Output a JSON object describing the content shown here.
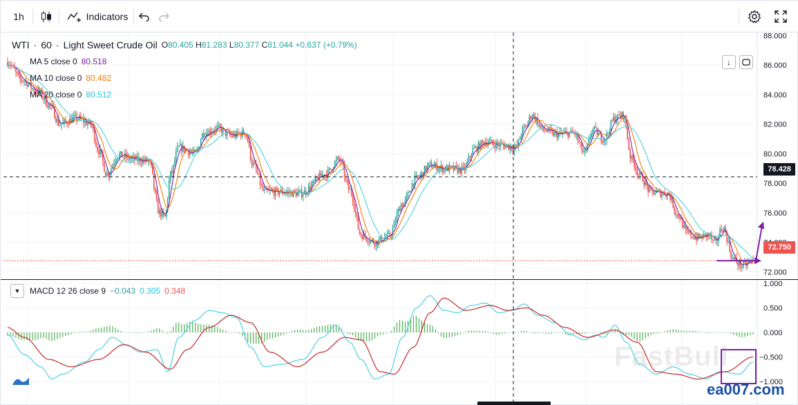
{
  "toolbar": {
    "interval": "1h",
    "indicators_label": "Indicators"
  },
  "legend": {
    "symbol": "WTI",
    "interval": "60",
    "name": "Light Sweet Crude Oil",
    "o_key": "O",
    "o_val": "80.405",
    "h_key": "H",
    "h_val": "81.283",
    "l_key": "L",
    "l_val": "80.377",
    "c_key": "C",
    "c_val": "81.044",
    "change": "+0.637 (+0.79%)",
    "ma5_label": "MA 5 close 0",
    "ma5_val": "80.518",
    "ma10_label": "MA 10 close 0",
    "ma10_val": "80.482",
    "ma20_label": "MA 20 close 0",
    "ma20_val": "80.512"
  },
  "macd_legend": {
    "label": "MACD 12 26 close 9",
    "hist_val": "−0.043",
    "macd_val": "0.305",
    "signal_val": "0.348"
  },
  "price_tags": {
    "crosshair": "78.428",
    "last": "72.750"
  },
  "watermarks": {
    "primary": "FastBull",
    "secondary": "ea007.com"
  },
  "colors": {
    "up": "#26a69a",
    "down": "#ef5350",
    "ma5": "#7b1fa2",
    "ma10": "#f57c00",
    "ma20": "#4dd0e1",
    "macd": "#4dd0e1",
    "signal": "#c62828",
    "hist": "#4caf50",
    "crosshair_tag": "#131722",
    "last_tag": "#ef5350",
    "annotation": "#7b1fa2"
  },
  "chart_data": [
    {
      "type": "candlestick",
      "symbol": "WTI",
      "y_ticks": [
        88,
        86,
        84,
        82,
        80,
        78,
        76,
        74,
        72
      ],
      "ylim": [
        71.5,
        88.2
      ],
      "crosshair_price": 78.428,
      "last_price": 72.75,
      "anchors": [
        [
          0,
          86.2
        ],
        [
          10,
          85.0
        ],
        [
          22,
          84.2
        ],
        [
          30,
          83.3
        ],
        [
          38,
          82.0
        ],
        [
          50,
          82.4
        ],
        [
          60,
          82.0
        ],
        [
          66,
          80.2
        ],
        [
          72,
          78.6
        ],
        [
          80,
          79.9
        ],
        [
          92,
          79.6
        ],
        [
          102,
          79.5
        ],
        [
          110,
          76.0
        ],
        [
          114,
          75.7
        ],
        [
          118,
          78.6
        ],
        [
          124,
          80.4
        ],
        [
          136,
          80.0
        ],
        [
          142,
          81.4
        ],
        [
          152,
          81.7
        ],
        [
          162,
          81.2
        ],
        [
          172,
          81.4
        ],
        [
          178,
          79.2
        ],
        [
          186,
          77.4
        ],
        [
          198,
          77.4
        ],
        [
          212,
          77.3
        ],
        [
          230,
          78.6
        ],
        [
          240,
          79.6
        ],
        [
          248,
          77.5
        ],
        [
          256,
          74.5
        ],
        [
          266,
          74.0
        ],
        [
          276,
          74.4
        ],
        [
          286,
          76.6
        ],
        [
          296,
          78.3
        ],
        [
          306,
          79.2
        ],
        [
          316,
          79.0
        ],
        [
          330,
          78.9
        ],
        [
          338,
          80.3
        ],
        [
          346,
          80.8
        ],
        [
          356,
          80.6
        ],
        [
          368,
          80.4
        ],
        [
          374,
          81.7
        ],
        [
          380,
          82.6
        ],
        [
          388,
          81.6
        ],
        [
          398,
          81.3
        ],
        [
          410,
          81.4
        ],
        [
          418,
          80.0
        ],
        [
          424,
          81.6
        ],
        [
          432,
          81.0
        ],
        [
          440,
          82.4
        ],
        [
          446,
          82.6
        ],
        [
          452,
          79.6
        ],
        [
          458,
          78.5
        ],
        [
          466,
          77.4
        ],
        [
          478,
          77.3
        ],
        [
          486,
          75.8
        ],
        [
          492,
          74.6
        ],
        [
          500,
          74.3
        ],
        [
          508,
          74.5
        ],
        [
          512,
          73.9
        ],
        [
          518,
          75.0
        ],
        [
          526,
          72.8
        ],
        [
          532,
          72.4
        ],
        [
          540,
          72.75
        ]
      ],
      "moving_averages": [
        {
          "label": "MA 5 close 0",
          "period": 5,
          "value": 80.518
        },
        {
          "label": "MA 10 close 0",
          "period": 10,
          "value": 80.482
        },
        {
          "label": "MA 20 close 0",
          "period": 20,
          "value": 80.512
        }
      ],
      "annotation": {
        "type": "arrow-up",
        "from": 72.75,
        "to": 75.4
      }
    },
    {
      "type": "line",
      "name": "MACD 12 26 close 9",
      "y_ticks": [
        1.0,
        0.5,
        0.0,
        -0.5,
        -1.0
      ],
      "ylim": [
        -1.0,
        1.0
      ],
      "macd_anchors": [
        [
          0,
          -0.05
        ],
        [
          12,
          -0.45
        ],
        [
          24,
          -0.7
        ],
        [
          32,
          -0.95
        ],
        [
          40,
          -0.85
        ],
        [
          56,
          -0.6
        ],
        [
          66,
          -0.35
        ],
        [
          76,
          -0.1
        ],
        [
          86,
          -0.25
        ],
        [
          96,
          -0.4
        ],
        [
          108,
          -0.35
        ],
        [
          116,
          -0.8
        ],
        [
          124,
          -0.1
        ],
        [
          136,
          0.25
        ],
        [
          146,
          0.45
        ],
        [
          156,
          0.4
        ],
        [
          166,
          0.3
        ],
        [
          176,
          -0.3
        ],
        [
          186,
          -0.7
        ],
        [
          198,
          -0.65
        ],
        [
          214,
          -0.55
        ],
        [
          228,
          -0.1
        ],
        [
          238,
          0.15
        ],
        [
          248,
          -0.2
        ],
        [
          256,
          -0.55
        ],
        [
          266,
          -0.95
        ],
        [
          276,
          -0.85
        ],
        [
          286,
          -0.1
        ],
        [
          296,
          0.5
        ],
        [
          306,
          0.75
        ],
        [
          316,
          0.45
        ],
        [
          326,
          0.4
        ],
        [
          336,
          0.55
        ],
        [
          346,
          0.6
        ],
        [
          356,
          0.4
        ],
        [
          366,
          0.45
        ],
        [
          374,
          0.58
        ],
        [
          384,
          0.35
        ],
        [
          396,
          0.2
        ],
        [
          408,
          -0.05
        ],
        [
          418,
          -0.15
        ],
        [
          426,
          -0.05
        ],
        [
          432,
          -0.1
        ],
        [
          440,
          0.15
        ],
        [
          448,
          -0.2
        ],
        [
          458,
          -0.65
        ],
        [
          470,
          -0.85
        ],
        [
          482,
          -0.7
        ],
        [
          494,
          -0.85
        ],
        [
          506,
          -0.95
        ],
        [
          516,
          -0.8
        ],
        [
          530,
          -0.85
        ],
        [
          540,
          -0.6
        ]
      ],
      "signal_anchors": [
        [
          0,
          0.1
        ],
        [
          12,
          -0.1
        ],
        [
          30,
          -0.55
        ],
        [
          46,
          -0.7
        ],
        [
          66,
          -0.55
        ],
        [
          84,
          -0.25
        ],
        [
          100,
          -0.4
        ],
        [
          118,
          -0.75
        ],
        [
          130,
          -0.35
        ],
        [
          146,
          0.1
        ],
        [
          162,
          0.35
        ],
        [
          176,
          0.2
        ],
        [
          190,
          -0.4
        ],
        [
          210,
          -0.7
        ],
        [
          228,
          -0.4
        ],
        [
          244,
          -0.1
        ],
        [
          256,
          -0.15
        ],
        [
          270,
          -0.8
        ],
        [
          280,
          -0.85
        ],
        [
          294,
          -0.3
        ],
        [
          306,
          0.4
        ],
        [
          316,
          0.7
        ],
        [
          332,
          0.45
        ],
        [
          350,
          0.55
        ],
        [
          362,
          0.45
        ],
        [
          376,
          0.5
        ],
        [
          388,
          0.35
        ],
        [
          404,
          0.1
        ],
        [
          420,
          -0.1
        ],
        [
          440,
          0.05
        ],
        [
          456,
          -0.2
        ],
        [
          470,
          -0.8
        ],
        [
          484,
          -0.85
        ],
        [
          500,
          -0.95
        ],
        [
          520,
          -0.8
        ],
        [
          540,
          -0.5
        ]
      ]
    }
  ]
}
